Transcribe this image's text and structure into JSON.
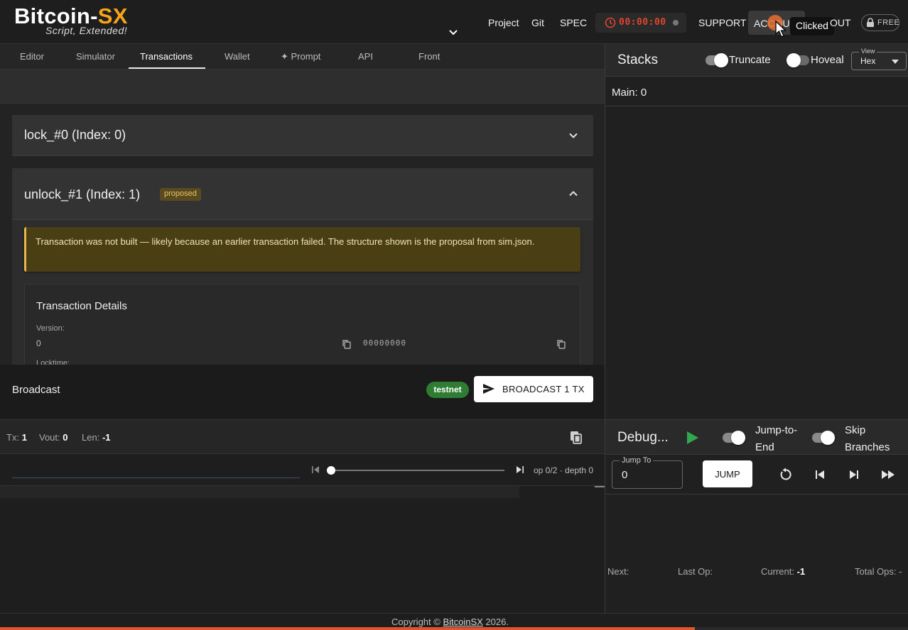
{
  "header": {
    "logo_main": "Bitcoin-",
    "logo_accent": "SX",
    "logo_sub": "Script, Extended!",
    "nav": [
      "Project",
      "Git",
      "SPEC"
    ],
    "timer": "00:00:00",
    "support": "SUPPORT",
    "account": "ACCOUNT",
    "logout_tail": "OUT",
    "tooltip": "Clicked",
    "plan": "FREE"
  },
  "tabs": [
    "Editor",
    "Simulator",
    "Transactions",
    "Wallet",
    "✦ Prompt",
    "API",
    "Front"
  ],
  "active_tab": "Transactions",
  "transactions": {
    "lock": {
      "title": "lock_#0 (Index: 0)"
    },
    "unlock": {
      "title": "unlock_#1 (Index: 1)",
      "badge": "proposed",
      "warning": "Transaction was not built — likely because an earlier transaction failed. The structure shown is the proposal from sim.json.",
      "details_title": "Transaction Details",
      "version_label": "Version:",
      "version_value": "0",
      "version_hex": "00000000",
      "locktime_label": "Locktime:"
    }
  },
  "broadcast": {
    "label": "Broadcast",
    "network": "testnet",
    "button": "BROADCAST 1 TX"
  },
  "txbar": {
    "tx_label": "Tx:",
    "tx_value": "1",
    "vout_label": "Vout:",
    "vout_value": "0",
    "len_label": "Len:",
    "len_value": "-1"
  },
  "scrubber": {
    "op_text": "op 0/2 · depth 0",
    "position": 0
  },
  "stacks": {
    "title": "Stacks",
    "truncate_label": "Truncate",
    "truncate_on": true,
    "hoveal_label": "Hoveal",
    "hoveal_on": false,
    "view_legend": "View",
    "view_value": "Hex",
    "main": "Main: 0"
  },
  "debug": {
    "title": "Debug...",
    "jump_to_end": "Jump-to-End",
    "skip_branches": "Skip Branches",
    "jump_legend": "Jump To",
    "jump_value": "0",
    "jump_button": "JUMP",
    "next_label": "Next:",
    "last_op_label": "Last Op:",
    "current_label": "Current:",
    "current_value": "-1",
    "total_ops_label": "Total Ops:",
    "total_ops_value": "-"
  },
  "footer": {
    "prefix": "Copyright © ",
    "link": "BitcoinSX",
    "suffix": " 2026."
  },
  "progress": 0.765,
  "colors": {
    "accent": "#f7a21b",
    "timer": "#e0452d",
    "testnet": "#2e7d32",
    "warning_bg": "#4a3e14",
    "progress": "#e0542a"
  }
}
